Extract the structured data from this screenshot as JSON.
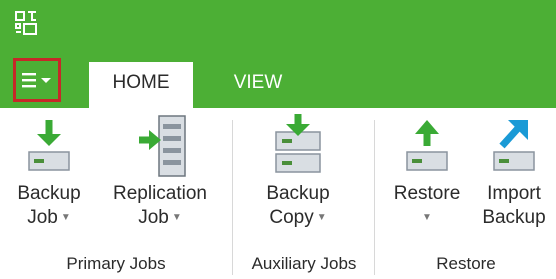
{
  "tabs": {
    "home": "HOME",
    "view": "VIEW"
  },
  "groups": {
    "primary": {
      "label": "Primary Jobs",
      "backup_job": {
        "line1": "Backup",
        "line2": "Job"
      },
      "replication_job": {
        "line1": "Replication",
        "line2": "Job"
      }
    },
    "auxiliary": {
      "label": "Auxiliary Jobs",
      "backup_copy": {
        "line1": "Backup",
        "line2": "Copy"
      }
    },
    "restore": {
      "label": "Restore",
      "restore": {
        "line1": "Restore"
      },
      "import_backup": {
        "line1": "Import",
        "line2": "Backup"
      }
    }
  },
  "icons": {
    "app": "app-logo-icon",
    "menu": "hamburger-menu-icon",
    "dropdown": "caret-down-icon",
    "backup_job": "backup-job-icon",
    "replication_job": "replication-job-icon",
    "backup_copy": "backup-copy-icon",
    "restore": "restore-icon",
    "import_backup": "import-backup-icon"
  },
  "colors": {
    "brand_green": "#4caf35",
    "highlight_red": "#c62828",
    "icon_green": "#3aaa35",
    "icon_blue": "#1a9ad6"
  }
}
